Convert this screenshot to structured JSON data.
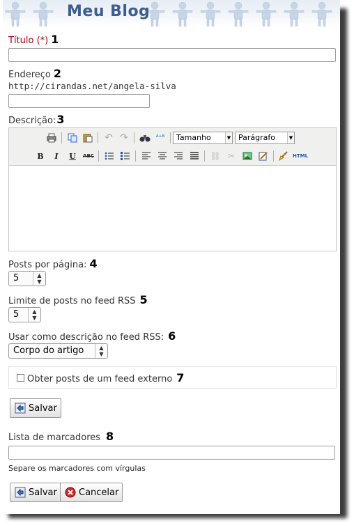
{
  "header": {
    "title": "Meu Blog"
  },
  "form": {
    "title_label": "Título (*)",
    "title_num": "1",
    "title_value": "",
    "address_label": "Endereço",
    "address_num": "2",
    "address_prefix": "http://cirandas.net/angela-silva",
    "address_value": "",
    "description_label": "Descrição:",
    "description_num": "3",
    "editor": {
      "font_size_select": "Tamanho",
      "format_select": "Parágrafo",
      "html_label": "HTML"
    },
    "posts_per_page_label": "Posts por página:",
    "posts_per_page_num": "4",
    "posts_per_page_value": "5",
    "feed_limit_label": "Limite de posts no feed RSS",
    "feed_limit_num": "5",
    "feed_limit_value": "5",
    "feed_desc_label": "Usar como descrição no feed RSS:",
    "feed_desc_num": "6",
    "feed_desc_value": "Corpo do artigo",
    "external_feed_label": "Obter posts de um feed externo",
    "external_feed_num": "7",
    "external_feed_checked": false,
    "save_label": "Salvar",
    "tags_label": "Lista de marcadores",
    "tags_num": "8",
    "tags_value": "",
    "tags_hint": "Separe os marcadores com vírgulas",
    "save_label_2": "Salvar",
    "cancel_label": "Cancelar"
  },
  "colors": {
    "title": "#3d5c8f",
    "required": "#a8000d"
  }
}
